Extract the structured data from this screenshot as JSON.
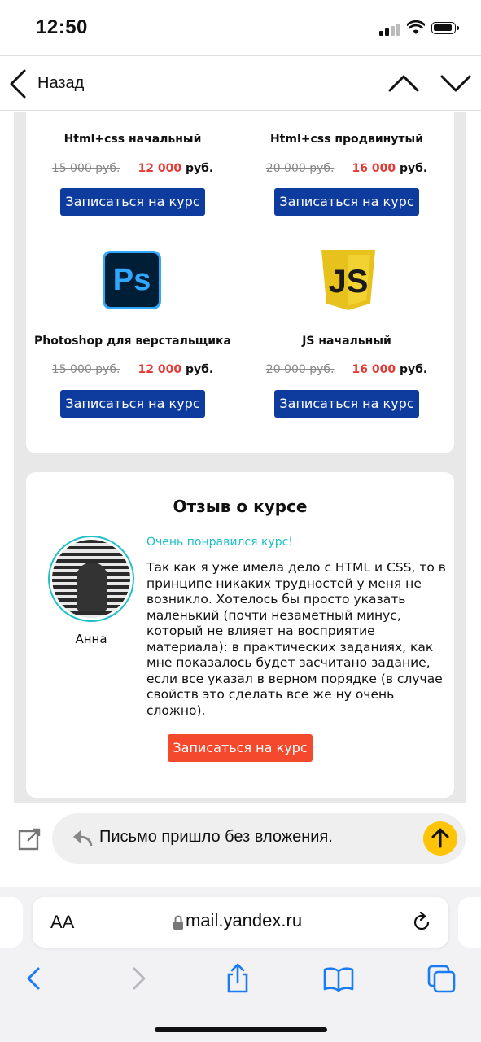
{
  "status_bar": {
    "time": "12:50"
  },
  "nav": {
    "back_label": "Назад"
  },
  "courses": [
    {
      "title": "Html+css начальный",
      "old_price": "15 000 руб.",
      "new_price": "12 000",
      "currency": "руб.",
      "button": "Записаться на курс"
    },
    {
      "title": "Html+css продвинутый",
      "old_price": "20 000 руб.",
      "new_price": "16 000",
      "currency": "руб.",
      "button": "Записаться на курс"
    },
    {
      "title": "Photoshop для верстальщика",
      "old_price": "15 000 руб.",
      "new_price": "12 000",
      "currency": "руб.",
      "button": "Записаться на курс",
      "logo": "Ps"
    },
    {
      "title": "JS начальный",
      "old_price": "20 000 руб.",
      "new_price": "16 000",
      "currency": "руб.",
      "button": "Записаться на курс",
      "logo": "JS"
    }
  ],
  "review": {
    "heading": "Отзыв о курсе",
    "tagline": "Очень понравился курс!",
    "text": "Так как я уже имела дело с HTML и CSS, то в принципе никаких трудностей у меня не возникло. Хотелось бы просто указать маленький (почти незаметный минус, который не влияет на восприятие материала): в практических заданиях, как мне показалось будет засчитано задание, если все указал в верном порядке (в случае свойств это сделать все же ну очень сложно).",
    "name": "Анна",
    "button": "Записаться на курс"
  },
  "reply": {
    "text": "Письмо пришло без вложения."
  },
  "safari": {
    "aa_label": "AA",
    "url": "mail.yandex.ru"
  },
  "colors": {
    "primary_button": "#0d3b9e",
    "accent_button": "#f4492d",
    "price_red": "#e53935",
    "teal": "#20c0c8",
    "send_yellow": "#fdc408"
  }
}
